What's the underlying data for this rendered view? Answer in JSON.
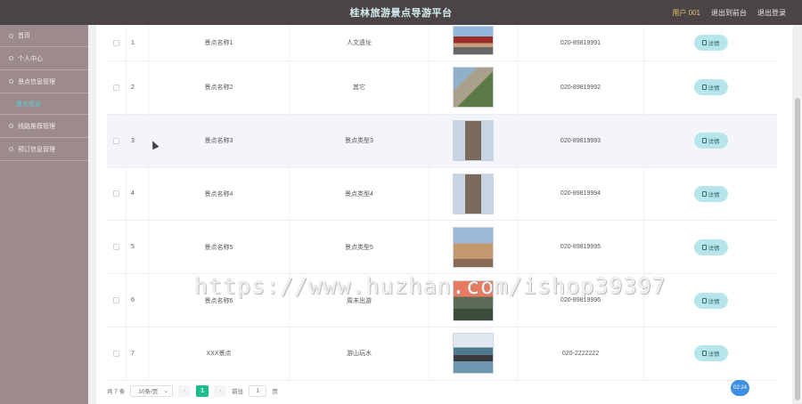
{
  "header": {
    "title": "桂林旅游景点导游平台",
    "user": "用户 001",
    "back_link": "退出到前台",
    "logout_link": "退出登录"
  },
  "sidebar": {
    "items": [
      {
        "label": "首页"
      },
      {
        "label": "个人中心"
      },
      {
        "label": "景点信息管理"
      },
      {
        "label": "景点信息"
      },
      {
        "label": "线路推荐管理"
      },
      {
        "label": "预订信息管理"
      }
    ]
  },
  "table": {
    "detail_label": "详情",
    "rows": [
      {
        "index": "1",
        "name": "景点名称1",
        "type": "人文遗址",
        "image": "gate",
        "phone": "020-89819991"
      },
      {
        "index": "2",
        "name": "景点名称2",
        "type": "其它",
        "image": "wall",
        "phone": "020-89819992"
      },
      {
        "index": "3",
        "name": "景点名称3",
        "type": "景点类型3",
        "image": "tower",
        "phone": "020-89819993"
      },
      {
        "index": "4",
        "name": "景点名称4",
        "type": "景点类型4",
        "image": "tower",
        "phone": "020-89819994"
      },
      {
        "index": "5",
        "name": "景点名称5",
        "type": "景点类型5",
        "image": "rock",
        "phone": "020-89819995"
      },
      {
        "index": "6",
        "name": "景点名称6",
        "type": "周末出游",
        "image": "red",
        "phone": "020-89819996"
      },
      {
        "index": "7",
        "name": "XXX景点",
        "type": "游山玩水",
        "image": "lake",
        "phone": "020-2222222"
      }
    ]
  },
  "pagination": {
    "total": "共 7 条",
    "page_size": "10条/页",
    "current": "1",
    "goto_prefix": "前往",
    "goto_value": "1",
    "goto_suffix": "页"
  },
  "float_badge": "02:24",
  "watermark": "https://www.huzhan.com/ishop39397"
}
